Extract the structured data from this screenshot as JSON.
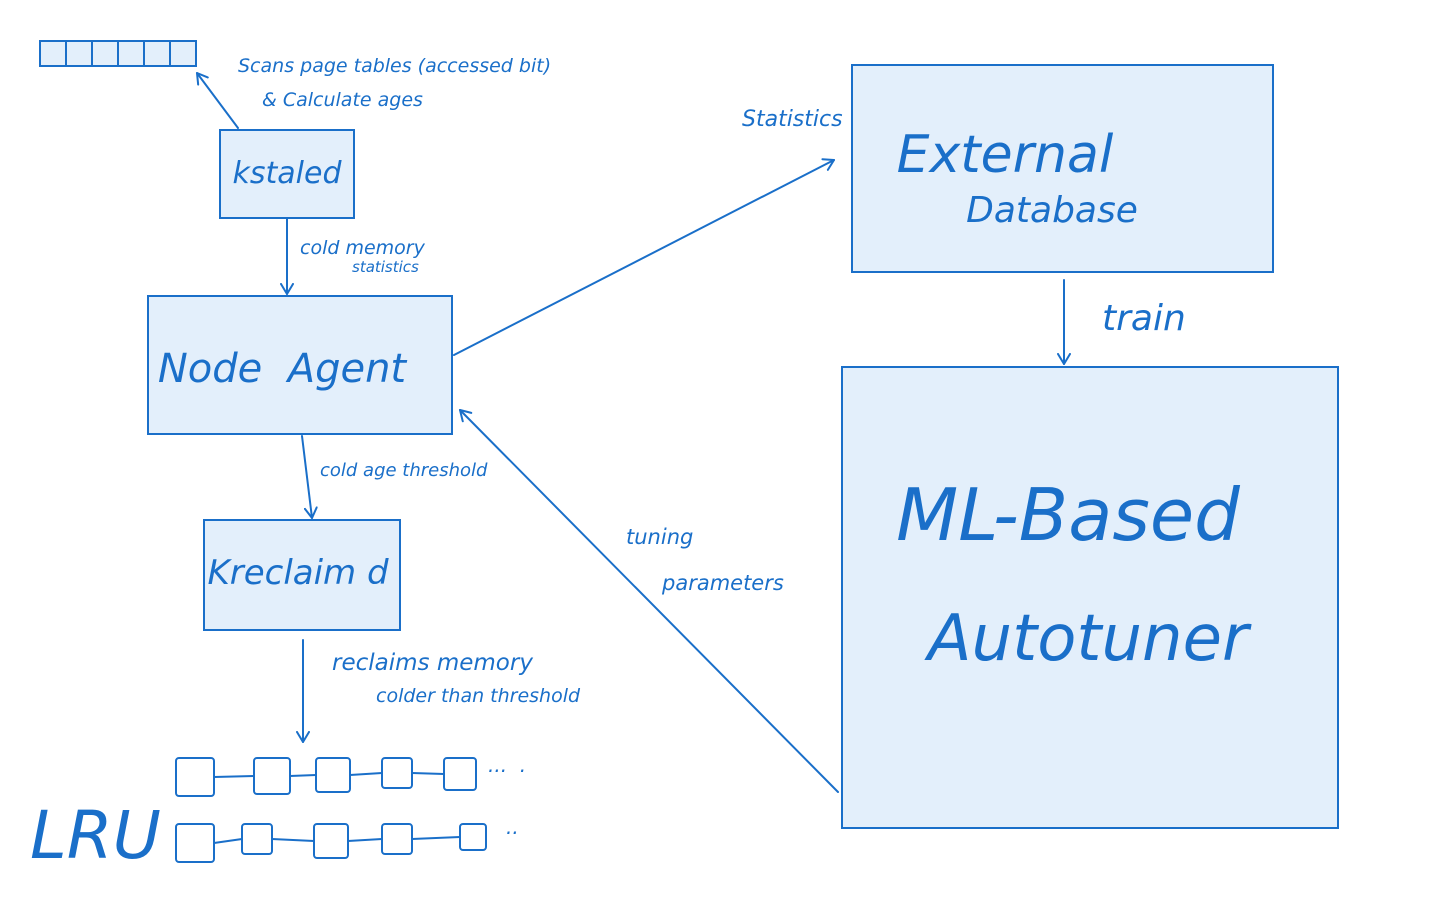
{
  "colors": {
    "ink": "#1a6fc9",
    "box_fill": "#e3effb",
    "background": "#ffffff"
  },
  "nodes": {
    "kstaled": "kstaled",
    "node_agent": "Node  Agent",
    "kreclaimd": "Kreclaim d",
    "external_database_line1": "External",
    "external_database_line2": "Database",
    "autotuner_line1": "ML-Based",
    "autotuner_line2": "Autotuner",
    "lru": "LRU"
  },
  "edges": {
    "scans_line1": "Scans page tables (accessed bit)",
    "scans_line2": "& Calculate ages",
    "cold_memory_line1": "cold memory",
    "cold_memory_line2": "statistics",
    "cold_age_threshold": "cold age threshold",
    "reclaims_line1": "reclaims memory",
    "reclaims_line2": "colder than threshold",
    "statistics": "Statistics",
    "train": "train",
    "tuning_line1": "tuning",
    "tuning_line2": "parameters"
  },
  "lru_lists": {
    "row1_ellipsis": "...  .",
    "row2_ellipsis": ".."
  },
  "page_table": {
    "cell_count": 6
  }
}
